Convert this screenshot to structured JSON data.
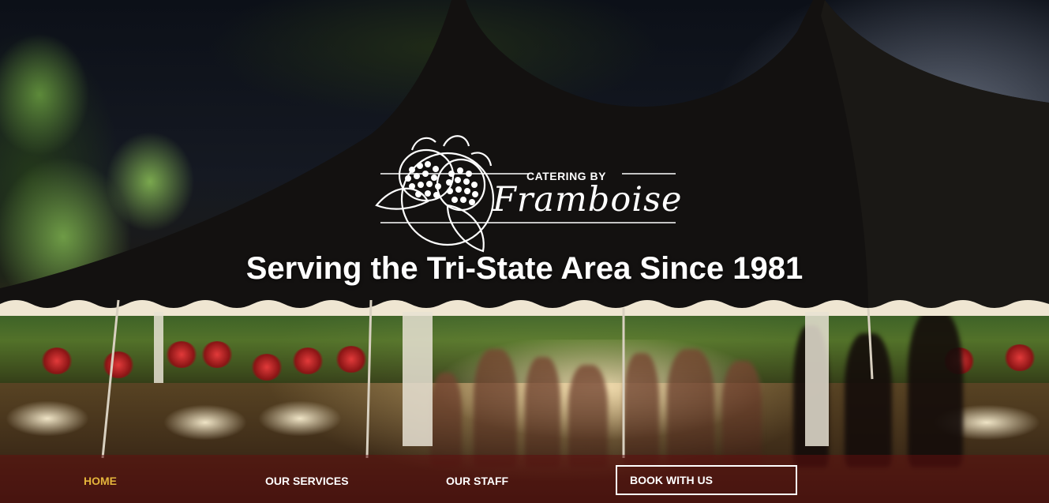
{
  "brand": {
    "catering_by": "CATERING BY",
    "name": "Framboise"
  },
  "hero": {
    "tagline": "Serving the Tri-State Area Since 1981"
  },
  "nav": {
    "items": [
      {
        "label": "HOME",
        "active": true
      },
      {
        "label": "OUR SERVICES",
        "active": false
      },
      {
        "label": "OUR STAFF",
        "active": false
      }
    ],
    "cta_label": "BOOK WITH US"
  },
  "colors": {
    "active_nav": "#e4b53b",
    "nav_bar": "#600e0e",
    "text": "#ffffff"
  }
}
